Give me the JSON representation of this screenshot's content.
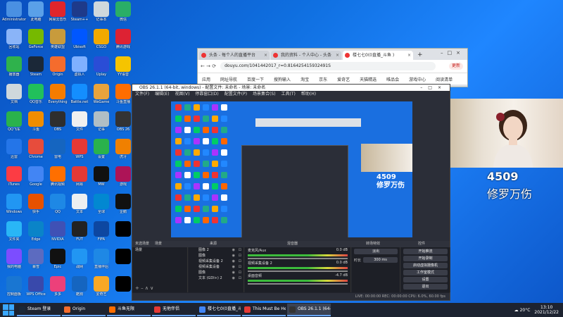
{
  "desktop_icons": [
    {
      "label": "Administrator",
      "color": "#4a90e2"
    },
    {
      "label": "此电脑",
      "color": "#5aa0e8"
    },
    {
      "label": "网易云音乐",
      "color": "#e0252b"
    },
    {
      "label": "Steam++",
      "color": "#1e3a8a"
    },
    {
      "label": "记事本",
      "color": "#cfd8dc"
    },
    {
      "label": "微信",
      "color": "#2aae67"
    },
    {
      "label": "回收站",
      "color": "#8ab4f8"
    },
    {
      "label": "GeForce",
      "color": "#76b900"
    },
    {
      "label": "英雄联盟",
      "color": "#c89b3c"
    },
    {
      "label": "Ubisoft",
      "color": "#0057ff"
    },
    {
      "label": "CSGO",
      "color": "#f2a900"
    },
    {
      "label": "腾讯游戏",
      "color": "#d23"
    },
    {
      "label": "播放器",
      "color": "#2fb24c"
    },
    {
      "label": "Steam",
      "color": "#1b2838"
    },
    {
      "label": "Origin",
      "color": "#f56c2d"
    },
    {
      "label": "虚拟人",
      "color": "#7fb0ff"
    },
    {
      "label": "Uplay",
      "color": "#2a4dd6"
    },
    {
      "label": "YY语音",
      "color": "#f5c400"
    },
    {
      "label": "文档",
      "color": "#cfd8dc"
    },
    {
      "label": "QQ音乐",
      "color": "#21c05b"
    },
    {
      "label": "Everything",
      "color": "#f57c00"
    },
    {
      "label": "Battle.net",
      "color": "#148eff"
    },
    {
      "label": "WeGame",
      "color": "#e8a33c"
    },
    {
      "label": "斗鱼直播",
      "color": "#ff6d00"
    },
    {
      "label": "QQ飞车",
      "color": "#2ab24c"
    },
    {
      "label": "斗鱼",
      "color": "#f08d00"
    },
    {
      "label": "OBS",
      "color": "#2e2e2e"
    },
    {
      "label": "文件",
      "color": "#f0f0f0"
    },
    {
      "label": "记事",
      "color": "#b0bec5"
    },
    {
      "label": "OBS 26",
      "color": "#333"
    },
    {
      "label": "迅雷",
      "color": "#2475e8"
    },
    {
      "label": "Chrome",
      "color": "#e74c3c"
    },
    {
      "label": "雷电",
      "color": "#1565c0"
    },
    {
      "label": "WPS",
      "color": "#e53935"
    },
    {
      "label": "设置",
      "color": "#2ab24c"
    },
    {
      "label": "虎牙",
      "color": "#f08000"
    },
    {
      "label": "iTunes",
      "color": "#fc3c44"
    },
    {
      "label": "Google",
      "color": "#4285f4"
    },
    {
      "label": "腾讯视频",
      "color": "#ff6f00"
    },
    {
      "label": "网易",
      "color": "#e53935"
    },
    {
      "label": "MW",
      "color": "#111"
    },
    {
      "label": "游戏",
      "color": "#ad1457"
    },
    {
      "label": "Windows",
      "color": "#2196f3"
    },
    {
      "label": "快手",
      "color": "#e65100"
    },
    {
      "label": "QQ",
      "color": "#1e88e5"
    },
    {
      "label": "文本",
      "color": "#eceff1"
    },
    {
      "label": "全球",
      "color": "#0288d1"
    },
    {
      "label": "企鹅",
      "color": "#111"
    },
    {
      "label": "文件夹",
      "color": "#29b6f6"
    },
    {
      "label": "Edge",
      "color": "#0a84c8"
    },
    {
      "label": "NVIDIA",
      "color": "#3f51b5"
    },
    {
      "label": "FUT",
      "color": "#222"
    },
    {
      "label": "FIFA",
      "color": "#0d47a1"
    },
    {
      "label": "",
      "color": "#000"
    },
    {
      "label": "我的电脑",
      "color": "#7c4dff"
    },
    {
      "label": "暴雪",
      "color": "#5c6bc0"
    },
    {
      "label": "Epic",
      "color": "#111"
    },
    {
      "label": "战网",
      "color": "#2196f3"
    },
    {
      "label": "直播伴侣",
      "color": "#1e88e5"
    },
    {
      "label": "",
      "color": "#000"
    },
    {
      "label": "控制面板",
      "color": "#1976d2"
    },
    {
      "label": "WPS Office",
      "color": "#3949ab"
    },
    {
      "label": "多多",
      "color": "#ec407a"
    },
    {
      "label": "酷狗",
      "color": "#1565c0"
    },
    {
      "label": "爱奇艺",
      "color": "#f9a825"
    },
    {
      "label": "",
      "color": "#000"
    }
  ],
  "browser": {
    "tabs": [
      "头条 - 每个人的直播平台",
      "我的资料 - 个人中心 - 头条",
      "楼七七0(0直播_斗鱼 )"
    ],
    "url": "douyu.com/1041442017_r=0.816425415932491S",
    "update_label": "更新",
    "bookmarks": [
      "应用",
      "网址导航",
      "百度一下",
      "搜狗输入",
      "淘宝",
      "京东",
      "爱奇艺",
      "天猫精选",
      "唯品会",
      "游戏中心",
      "阅读清单"
    ]
  },
  "camera": {
    "number": "4509",
    "name": "修罗万伤"
  },
  "obs": {
    "title": "OBS 26.1.1 (64-bit, windows) - 配置文件: 未命名 - 场景: 未命名",
    "menu": [
      "文件(F)",
      "编辑(E)",
      "视图(V)",
      "停靠窗口(D)",
      "配置文件(P)",
      "场景集合(S)",
      "工具(T)",
      "帮助(H)"
    ],
    "preview_number": "4509",
    "preview_name": "修罗万伤",
    "dock_labels": {
      "noscene": "未选场景",
      "scenes": "场景",
      "sources": "来源",
      "mixer": "混音器",
      "transitions": "转场特效",
      "controls": "控件"
    },
    "scenes": [
      "场景"
    ],
    "sources": [
      "图像 2",
      "图像",
      "视频采集设备 2",
      "视频采集设备",
      "图像",
      "文本 (GDI+) 2"
    ],
    "mixer": [
      {
        "name": "麦克风/Aux",
        "db": "0.0 dB"
      },
      {
        "name": "视频采集设备 2",
        "db": "0.0 dB"
      },
      {
        "name": "桌面音频",
        "db": "-4.7 dB"
      }
    ],
    "transition": {
      "type": "淡出",
      "duration_label": "时长",
      "duration": "300 ms"
    },
    "controls": [
      "开始推流",
      "开始录制",
      "启动虚拟摄像机",
      "工作室模式",
      "设置",
      "退出"
    ],
    "status": "LIVE: 00:00:00   REC: 00:00:00   CPU: 6.0%, 60.00 fps"
  },
  "taskbar": {
    "items": [
      {
        "label": "Steam 登录",
        "color": "#1b2838"
      },
      {
        "label": "Origin",
        "color": "#f56c2d"
      },
      {
        "label": "斗鱼无限",
        "color": "#ff6d00"
      },
      {
        "label": "无他伴侣",
        "color": "#e53935"
      },
      {
        "label": "楼七七0(0直播_斗...",
        "color": "#4285f4"
      },
      {
        "label": "This Must Be Hell...",
        "color": "#e53935"
      },
      {
        "label": "OBS 26.1.1 (64-bit...",
        "color": "#333"
      }
    ],
    "weather": "20°C",
    "time": "13:10",
    "date": "2021/12/22"
  }
}
